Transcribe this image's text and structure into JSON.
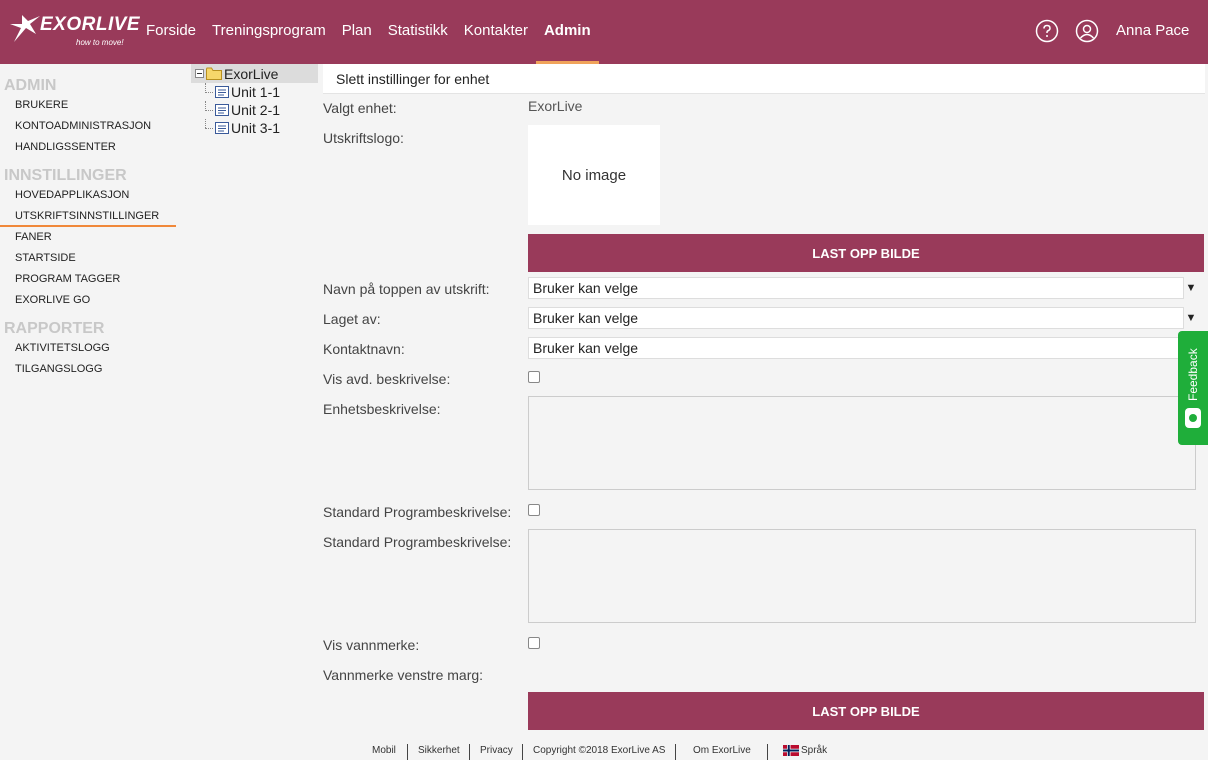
{
  "header": {
    "logo_text": "EXORLIVE",
    "logo_tagline": "how to move!",
    "nav": [
      "Forside",
      "Treningsprogram",
      "Plan",
      "Statistikk",
      "Kontakter",
      "Admin"
    ],
    "active_nav": "Admin",
    "user_name": "Anna Pace",
    "accent_color": "#993a5a"
  },
  "sidebar": {
    "sections": [
      {
        "title": "ADMIN",
        "items": [
          "BRUKERE",
          "KONTOADMINISTRASJON",
          "HANDLIGSSENTER"
        ]
      },
      {
        "title": "INNSTILLINGER",
        "items": [
          "HOVEDAPPLIKASJON",
          "UTSKRIFTSINNSTILLINGER",
          "FANER",
          "STARTSIDE",
          "PROGRAM TAGGER",
          "EXORLIVE GO"
        ]
      },
      {
        "title": "RAPPORTER",
        "items": [
          "AKTIVITETSLOGG",
          "TILGANGSLOGG"
        ]
      }
    ],
    "active_item": "UTSKRIFTSINNSTILLINGER"
  },
  "tree": {
    "root": "ExorLive",
    "children": [
      "Unit 1-1",
      "Unit 2-1",
      "Unit 3-1"
    ]
  },
  "panel": {
    "title": "Slett instillinger for enhet",
    "selected_unit_label": "Valgt enhet:",
    "selected_unit_value": "ExorLive",
    "print_logo_label": "Utskriftslogo:",
    "no_image_text": "No image",
    "upload_button": "LAST OPP BILDE",
    "top_name_label": "Navn på toppen av utskrift:",
    "top_name_value": "Bruker kan velge",
    "made_by_label": "Laget av:",
    "made_by_value": "Bruker kan velge",
    "contact_name_label": "Kontaktnavn:",
    "contact_name_value": "Bruker kan velge",
    "show_dept_desc_label": "Vis avd. beskrivelse:",
    "unit_desc_label": "Enhetsbeskrivelse:",
    "std_program_desc_check_label": "Standard Programbeskrivelse:",
    "std_program_desc_label": "Standard Programbeskrivelse:",
    "show_watermark_label": "Vis vannmerke:",
    "watermark_left_margin_label": "Vannmerke venstre marg:",
    "upload_button_2": "LAST OPP BILDE"
  },
  "feedback": {
    "label": "Feedback",
    "color": "#1fae3a"
  },
  "footer": {
    "links": [
      "Mobil",
      "Sikkerhet",
      "Privacy",
      "Copyright ©2018 ExorLive AS",
      "Om ExorLive",
      "Språk"
    ]
  }
}
